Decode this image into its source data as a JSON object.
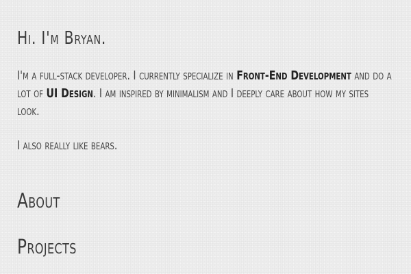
{
  "intro": {
    "greeting": "Hi. I'm Bryan.",
    "bio_part1": "I'm a full-stack developer. I currently specialize in ",
    "bio_highlight1": "Front-End Development",
    "bio_part2": " and do a lot of ",
    "bio_highlight2": "UI Design",
    "bio_part3": ". I am inspired by minimalism and I deeply care about how my sites look.",
    "bears": "I also really like bears."
  },
  "nav": {
    "about": "About",
    "projects": "Projects"
  }
}
